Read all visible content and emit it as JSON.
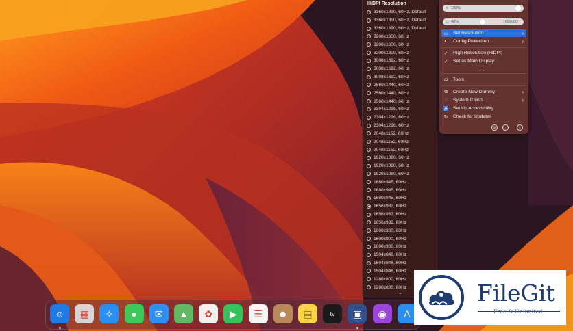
{
  "resolution_menu": {
    "header": "HiDPI Resolution",
    "items": [
      {
        "label": "3360x1890, 60Hz, Default",
        "selected": false
      },
      {
        "label": "3360x1890, 60Hz, Default",
        "selected": false
      },
      {
        "label": "3360x1890, 60Hz, Default",
        "selected": false
      },
      {
        "label": "3200x1800, 60Hz",
        "selected": false
      },
      {
        "label": "3200x1800, 60Hz",
        "selected": false
      },
      {
        "label": "3200x1800, 60Hz",
        "selected": false
      },
      {
        "label": "3008x1692, 60Hz",
        "selected": false
      },
      {
        "label": "3008x1692, 60Hz",
        "selected": false
      },
      {
        "label": "3008x1692, 60Hz",
        "selected": false
      },
      {
        "label": "2560x1440, 60Hz",
        "selected": false
      },
      {
        "label": "2560x1440, 60Hz",
        "selected": false
      },
      {
        "label": "2560x1440, 60Hz",
        "selected": false
      },
      {
        "label": "2304x1296, 60Hz",
        "selected": false
      },
      {
        "label": "2304x1296, 60Hz",
        "selected": false
      },
      {
        "label": "2304x1296, 60Hz",
        "selected": false
      },
      {
        "label": "2048x1152, 60Hz",
        "selected": false
      },
      {
        "label": "2048x1152, 60Hz",
        "selected": false
      },
      {
        "label": "2048x1152, 60Hz",
        "selected": false
      },
      {
        "label": "1920x1080, 60Hz",
        "selected": false
      },
      {
        "label": "1920x1080, 60Hz",
        "selected": false
      },
      {
        "label": "1920x1080, 60Hz",
        "selected": false
      },
      {
        "label": "1680x945, 60Hz",
        "selected": false
      },
      {
        "label": "1680x945, 60Hz",
        "selected": false
      },
      {
        "label": "1680x945, 60Hz",
        "selected": false
      },
      {
        "label": "1656x932, 60Hz",
        "selected": true
      },
      {
        "label": "1656x932, 60Hz",
        "selected": false
      },
      {
        "label": "1656x932, 60Hz",
        "selected": false
      },
      {
        "label": "1600x900, 60Hz",
        "selected": false
      },
      {
        "label": "1600x900, 60Hz",
        "selected": false
      },
      {
        "label": "1600x900, 60Hz",
        "selected": false
      },
      {
        "label": "1504x846, 60Hz",
        "selected": false
      },
      {
        "label": "1504x846, 60Hz",
        "selected": false
      },
      {
        "label": "1504x846, 60Hz",
        "selected": false
      },
      {
        "label": "1280x800, 60Hz",
        "selected": false
      },
      {
        "label": "1280x800, 60Hz",
        "selected": false
      }
    ],
    "more_indicator": "⌄"
  },
  "app_menu": {
    "brightness": {
      "label": "100%",
      "level": 1.0,
      "icon": "sun-icon"
    },
    "resolution_slider": {
      "label": "49%",
      "level": 0.49,
      "value": "1656x932",
      "icon": "display-icon"
    },
    "items": [
      {
        "label": "Set Resolution",
        "icon": "display-icon",
        "glyph": "▭",
        "has_submenu": true,
        "selected": true
      },
      {
        "label": "Config Protection",
        "icon": "shield-icon",
        "glyph": "◐",
        "has_submenu": true,
        "selected": false
      },
      {
        "label": "High Resolution (HiDPI)",
        "icon": "check-circle-icon",
        "glyph": "✓",
        "has_submenu": false,
        "selected": false
      },
      {
        "label": "Set as Main Display",
        "icon": "check-circle-icon",
        "glyph": "✓",
        "has_submenu": false,
        "selected": false
      }
    ],
    "tools_label": "Tools",
    "tools_items": [
      {
        "label": "Create New Dummy",
        "icon": "copy-icon",
        "glyph": "⧉",
        "has_submenu": true
      },
      {
        "label": "System Colors",
        "icon": "palette-icon",
        "glyph": "◌",
        "has_submenu": true
      },
      {
        "label": "Set Up Accessibility",
        "icon": "accessibility-icon",
        "glyph": "♿",
        "has_submenu": false
      },
      {
        "label": "Check for Updates",
        "icon": "refresh-icon",
        "glyph": "↻",
        "has_submenu": false
      }
    ],
    "bottom_icons": [
      "settings-icon",
      "more-icon",
      "quit-icon"
    ]
  },
  "dock": {
    "apps": [
      {
        "name": "finder",
        "glyph": "☺",
        "bg": "#1f7ae6",
        "running": true
      },
      {
        "name": "launchpad",
        "glyph": "▦",
        "bg": "#d9d4d6",
        "running": false
      },
      {
        "name": "safari",
        "glyph": "✧",
        "bg": "#2a8ff0",
        "running": false
      },
      {
        "name": "messages",
        "glyph": "●",
        "bg": "#3cc95a",
        "running": false
      },
      {
        "name": "mail",
        "glyph": "✉",
        "bg": "#2e8ef2",
        "running": false
      },
      {
        "name": "maps",
        "glyph": "▲",
        "bg": "#62b864",
        "running": false
      },
      {
        "name": "photos",
        "glyph": "✿",
        "bg": "#f4f0ee",
        "running": false
      },
      {
        "name": "facetime",
        "glyph": "▶",
        "bg": "#36c25b",
        "running": false
      },
      {
        "name": "reminders",
        "glyph": "☰",
        "bg": "#f5f5f5",
        "running": false
      },
      {
        "name": "contacts",
        "glyph": "☻",
        "bg": "#b88a5a",
        "running": false
      },
      {
        "name": "notes",
        "glyph": "▤",
        "bg": "#f9d447",
        "running": false
      },
      {
        "name": "tv",
        "glyph": "tv",
        "bg": "#1a1a1a",
        "running": false
      },
      {
        "name": "betterdisplay",
        "glyph": "▣",
        "bg": "#2f4f8f",
        "running": true
      },
      {
        "name": "podcasts",
        "glyph": "◉",
        "bg": "#9b45d9",
        "running": false
      },
      {
        "name": "app-store",
        "glyph": "A",
        "bg": "#2a8ff0",
        "running": false
      }
    ]
  },
  "watermark": {
    "brand": "FileGit",
    "tagline": "Free & Unlimited"
  }
}
